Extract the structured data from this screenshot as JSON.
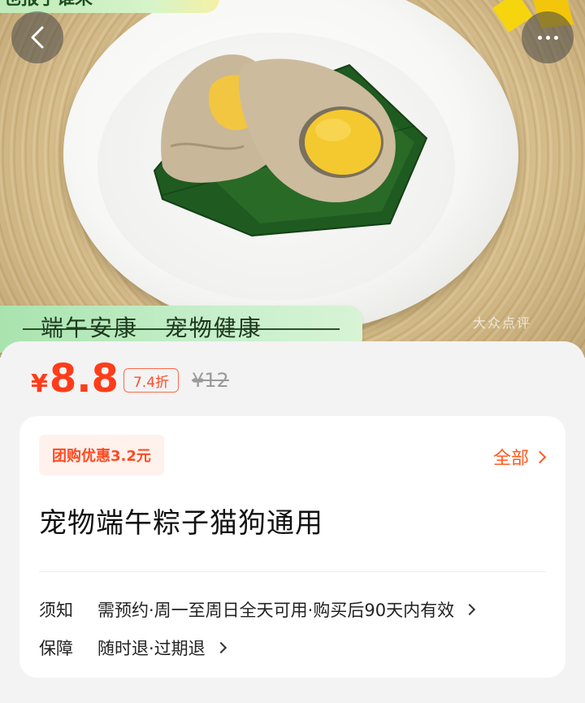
{
  "hero": {
    "top_banner_text": "也报了谁来",
    "slogan": "端午安康   宠物健康",
    "watermark": "大众点评"
  },
  "nav": {
    "back_icon": "chevron-left-icon",
    "more_icon": "ellipsis-icon"
  },
  "price": {
    "symbol": "¥",
    "current": "8.8",
    "discount": "7.4折",
    "original": "¥12"
  },
  "card": {
    "group_discount": "团购优惠3.2元",
    "all_link": "全部",
    "title": "宠物端午粽子猫狗通用",
    "notice_label": "须知",
    "notice_value": "需预约·周一至周日全天可用·购买后90天内有效",
    "guarantee_label": "保障",
    "guarantee_value": "随时退·过期退"
  },
  "colors": {
    "accent": "#ff3c1a",
    "slogan_green": "#a9e3ae",
    "sheet_bg": "#f3f3f3"
  }
}
